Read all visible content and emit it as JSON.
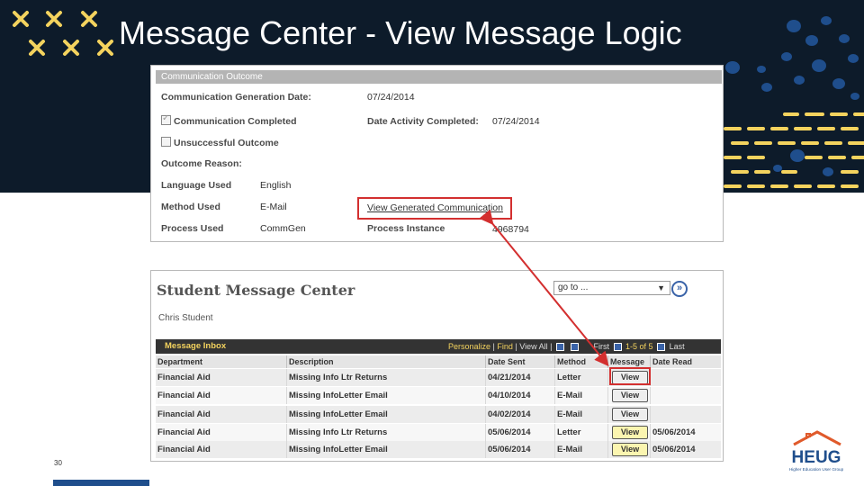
{
  "slide": {
    "title": "Message Center - View Message Logic",
    "slide_number": "30",
    "logo": {
      "name": "HEUG",
      "tagline": "Higher Education User Group"
    }
  },
  "outcome_panel": {
    "header": "Communication Outcome",
    "generation_date_label": "Communication Generation Date:",
    "generation_date": "07/24/2014",
    "completed_label": "Communication Completed",
    "completed_checked": true,
    "date_activity_label": "Date Activity Completed:",
    "date_activity": "07/24/2014",
    "unsuccessful_label": "Unsuccessful Outcome",
    "unsuccessful_checked": false,
    "outcome_reason_label": "Outcome Reason:",
    "language_label": "Language Used",
    "language": "English",
    "method_label": "Method Used",
    "method": "E-Mail",
    "view_link": "View Generated Communication",
    "process_used_label": "Process Used",
    "process_used": "CommGen",
    "process_instance_label": "Process Instance",
    "process_instance": "4968794"
  },
  "message_center": {
    "title": "Student Message Center",
    "subtitle": "Chris Student",
    "goto_placeholder": "go to ...",
    "inbox_title": "Message Inbox",
    "tools": {
      "personalize": "Personalize",
      "find": "Find",
      "view_all": "View All",
      "first": "First",
      "range": "1-5 of 5",
      "last": "Last"
    },
    "columns": [
      "Department",
      "Description",
      "Date Sent",
      "Method",
      "Message",
      "Date Read"
    ],
    "rows": [
      {
        "department": "Financial Aid",
        "description": "Missing Info Ltr Returns",
        "date_sent": "04/21/2014",
        "method": "Letter",
        "button": "View",
        "date_read": "",
        "read": false
      },
      {
        "department": "Financial Aid",
        "description": "Missing InfoLetter Email",
        "date_sent": "04/10/2014",
        "method": "E-Mail",
        "button": "View",
        "date_read": "",
        "read": false
      },
      {
        "department": "Financial Aid",
        "description": "Missing InfoLetter Email",
        "date_sent": "04/02/2014",
        "method": "E-Mail",
        "button": "View",
        "date_read": "",
        "read": false
      },
      {
        "department": "Financial Aid",
        "description": "Missing Info Ltr Returns",
        "date_sent": "05/06/2014",
        "method": "Letter",
        "button": "View",
        "date_read": "05/06/2014",
        "read": true
      },
      {
        "department": "Financial Aid",
        "description": "Missing InfoLetter Email",
        "date_sent": "05/06/2014",
        "method": "E-Mail",
        "button": "View",
        "date_read": "05/06/2014",
        "read": true
      }
    ]
  },
  "colors": {
    "banner": "#0d1b2a",
    "accent_yellow": "#f4d35e",
    "deco_blue": "#1f4e8c",
    "highlight_red": "#d32f2f"
  }
}
